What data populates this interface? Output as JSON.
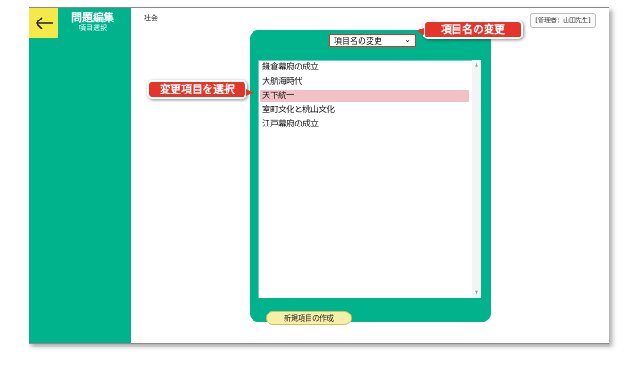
{
  "sidebar": {
    "back_icon": "arrow-left-icon",
    "title": "問題編集",
    "subtitle": "項目選択"
  },
  "header": {
    "subject": "社会",
    "user_badge": "[管理者：山田先生]"
  },
  "panel": {
    "select_value": "項目名の変更",
    "items": [
      "鎌倉幕府の成立",
      "大航海時代",
      "天下統一",
      "室町文化と桃山文化",
      "江戸幕府の成立"
    ],
    "selected_index": 2,
    "new_button_label": "新規項目の作成"
  },
  "annotations": {
    "select_callout": "項目名の変更",
    "item_callout": "変更項目を選択"
  },
  "colors": {
    "sidebar": "#00b38c",
    "back_button": "#f5e94a",
    "selected_row": "#f1c1c4",
    "callout": "#e5342a",
    "new_button": "#f8efa6"
  }
}
